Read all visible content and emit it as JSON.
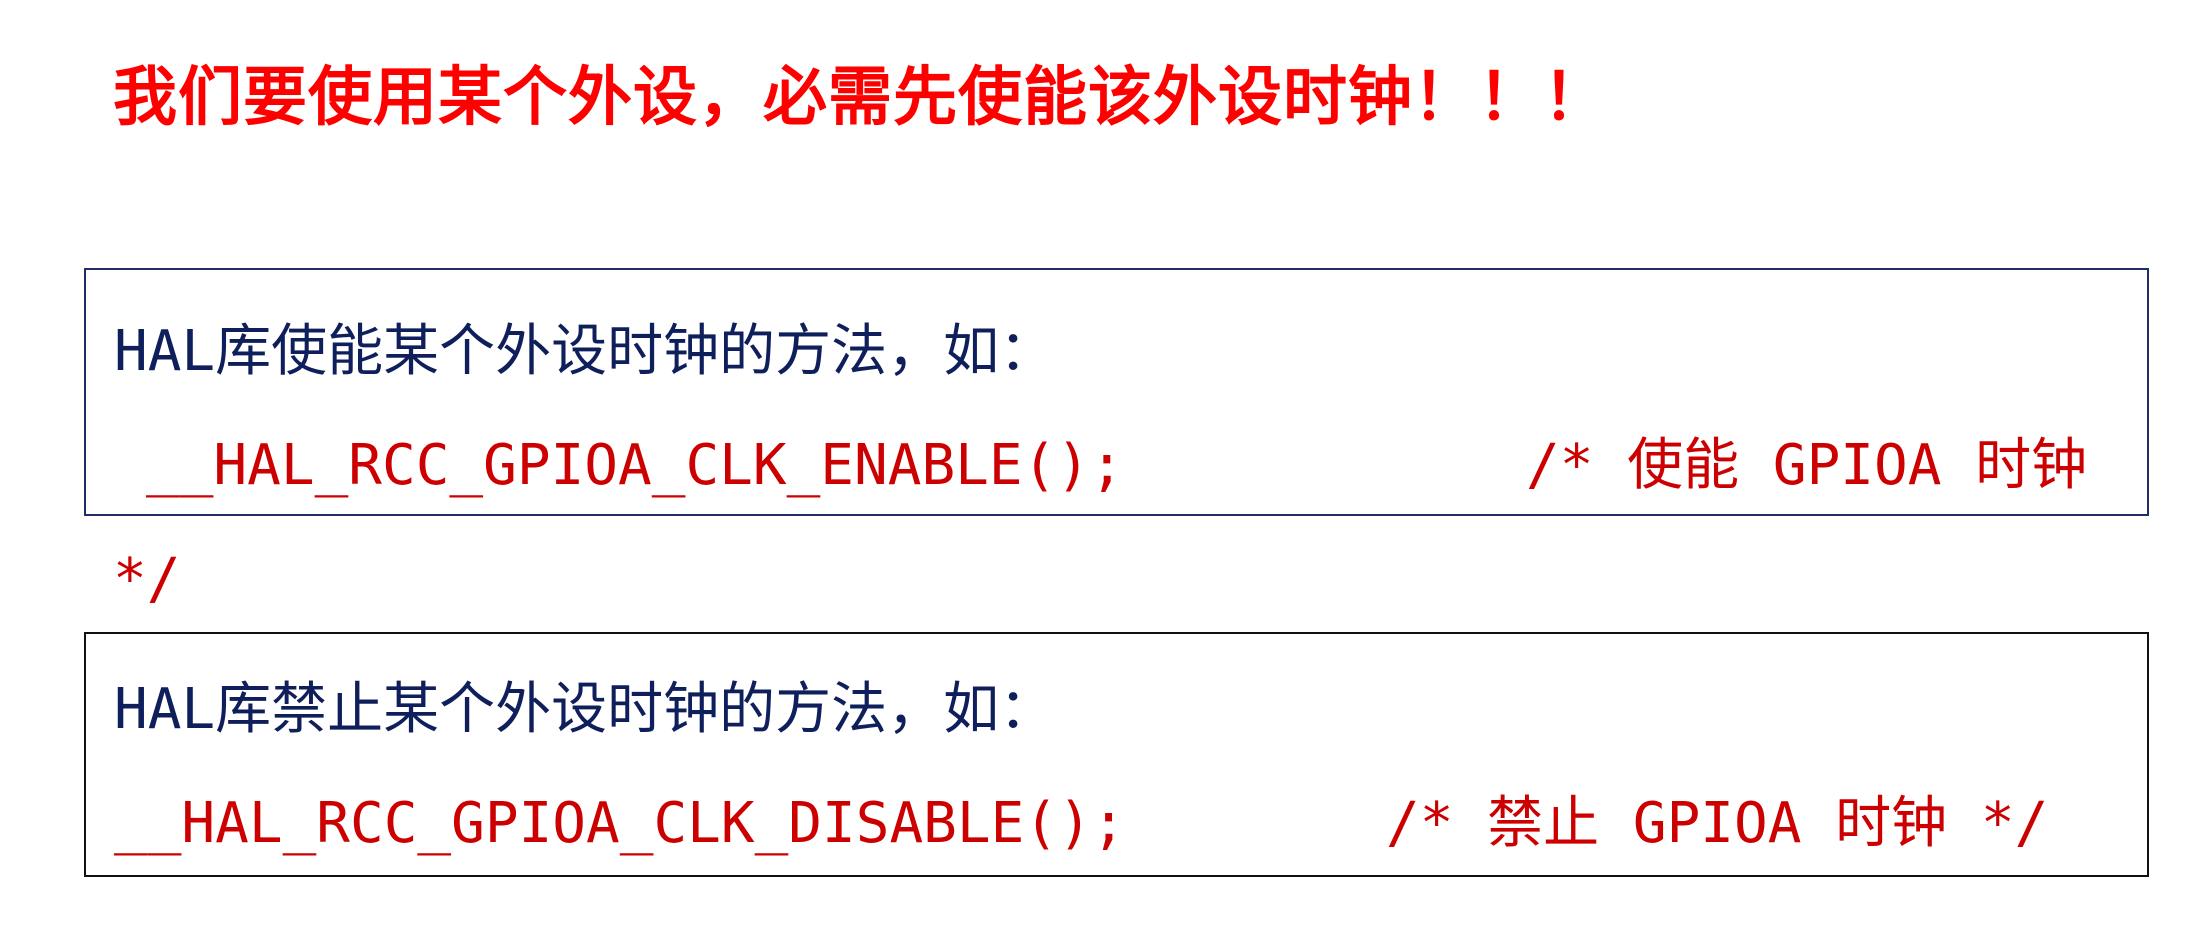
{
  "headline": "我们要使用某个外设，必需先使能该外设时钟！！！",
  "enable_box": {
    "title": "HAL库使能某个外设时钟的方法，如：",
    "code": "__HAL_RCC_GPIOA_CLK_ENABLE();",
    "comment": "/* 使能 GPIOA 时钟",
    "comment_overflow": "*/"
  },
  "disable_box": {
    "title": "HAL库禁止某个外设时钟的方法，如：",
    "code": "__HAL_RCC_GPIOA_CLK_DISABLE();",
    "comment": "/* 禁止 GPIOA 时钟 */"
  },
  "colors": {
    "headline": "#ff0000",
    "code": "#cc0000",
    "title_text": "#0f1f5c",
    "enable_border": "#1f2f66",
    "disable_border": "#111111"
  }
}
